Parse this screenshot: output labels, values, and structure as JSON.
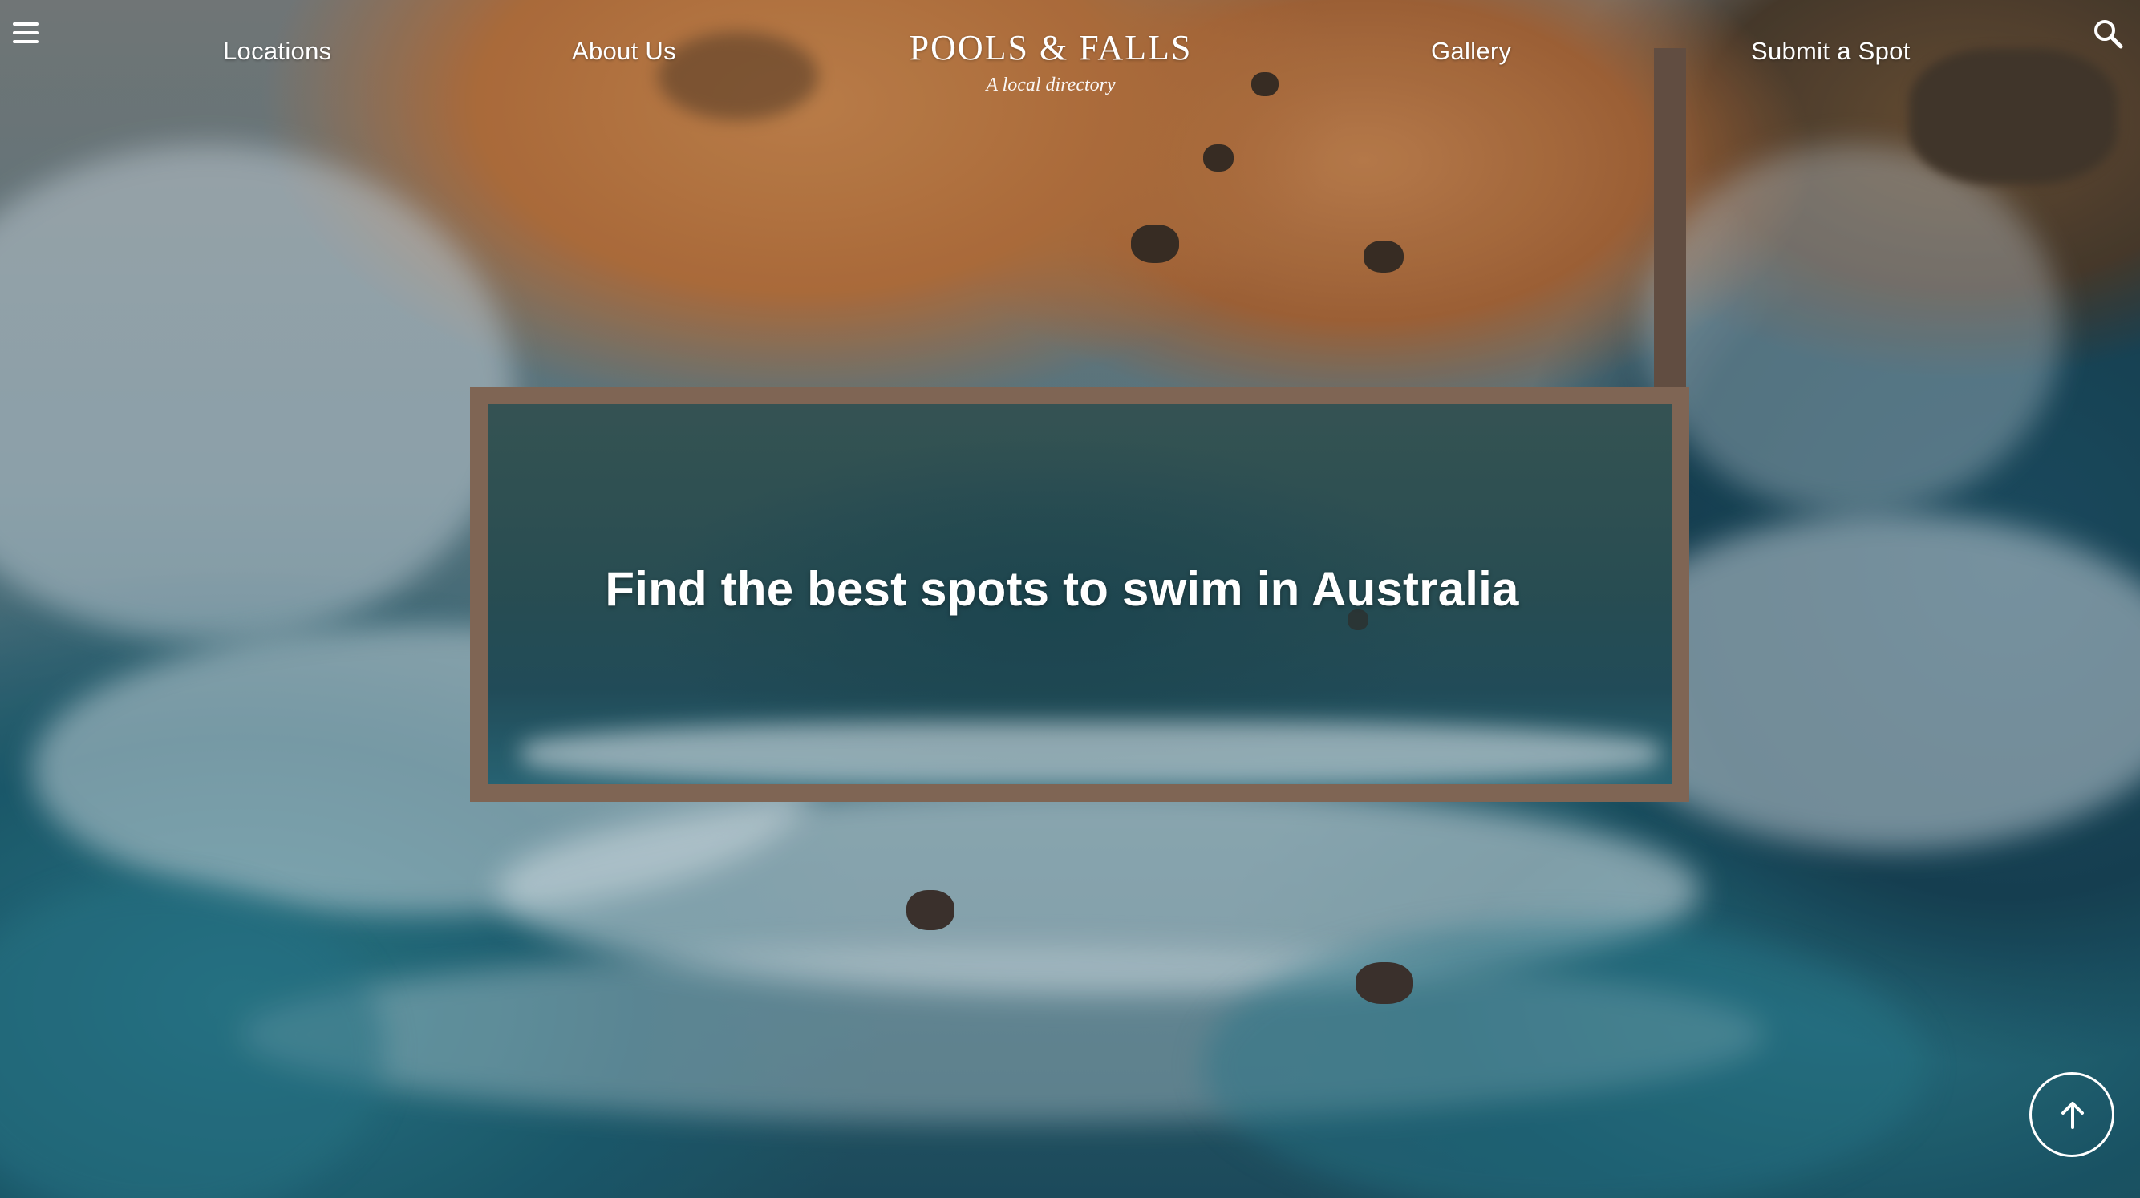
{
  "nav": {
    "left": [
      "Locations",
      "About Us"
    ],
    "right": [
      "Gallery",
      "Submit a Spot"
    ]
  },
  "logo": {
    "title": "POOLS & FALLS",
    "subtitle": "A local directory"
  },
  "hero": {
    "headline": "Find the best spots to swim in Australia"
  },
  "icons": {
    "menu": "hamburger-menu-icon",
    "search": "search-icon",
    "back_to_top": "arrow-up-icon"
  },
  "colors": {
    "text": "#ffffff"
  }
}
